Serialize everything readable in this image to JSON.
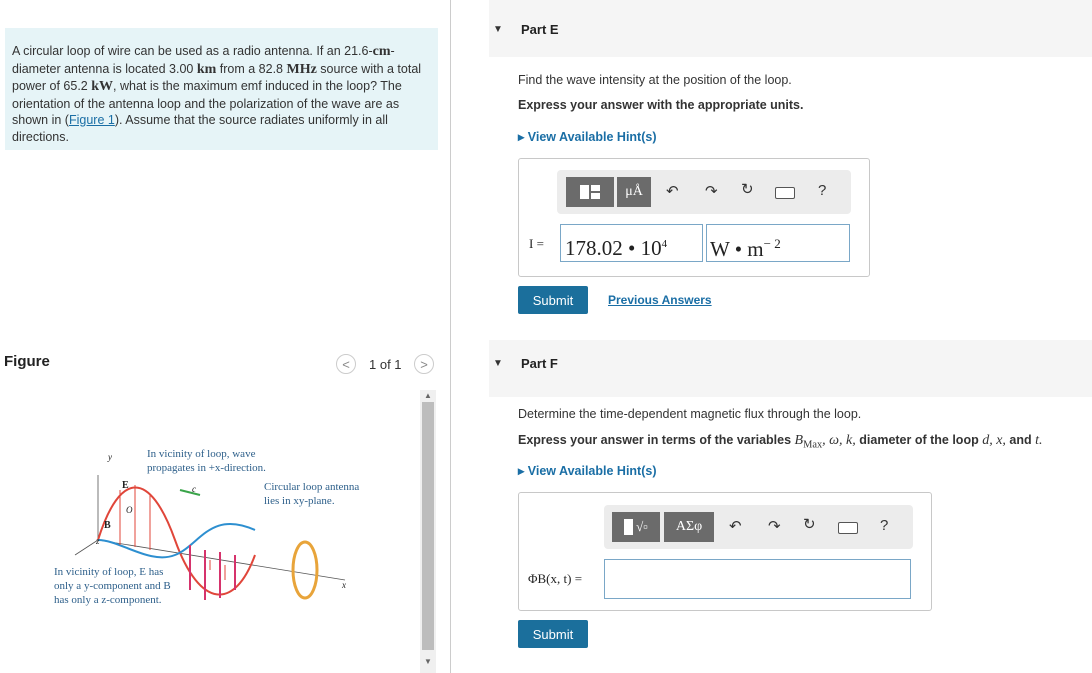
{
  "problem": {
    "text_1": "A circular loop of wire can be used as a radio antenna. If an 21.6-",
    "unit_cm": "cm",
    "text_2": "-diameter antenna is located 3.00 ",
    "unit_km": "km",
    "text_3": " from a 82.8 ",
    "unit_mhz": "MHz",
    "text_4": " source with a total power of 65.2 ",
    "unit_kw": "kW",
    "text_5": ", what is the maximum emf induced in the loop? The orientation of the antenna loop and the polarization of the wave are as shown in (",
    "figure_link": "Figure 1",
    "text_6": "). Assume that the source radiates uniformly in all directions."
  },
  "figure": {
    "title": "Figure",
    "counter": "1 of 1",
    "prev": "<",
    "next": ">",
    "caption_propagation": [
      "In vicinity of loop, wave",
      "propagates in +x-direction."
    ],
    "caption_loop": [
      "Circular loop antenna",
      "lies in xy-plane."
    ],
    "caption_components": [
      "In vicinity of loop, E has",
      "only a y-component and B",
      "has only a z-component."
    ],
    "labels": {
      "y": "y",
      "x": "x",
      "z": "z",
      "O": "O",
      "E": "E",
      "B": "B",
      "c": "c"
    }
  },
  "partE": {
    "label": "Part E",
    "question": "Find the wave intensity at the position of the loop.",
    "instruction": "Express your answer with the appropriate units.",
    "hint": "View Available Hint(s)",
    "toolbar_units": "μÅ",
    "help": "?",
    "var_label": "I =",
    "value": "178.02 • 10",
    "exponent": "4",
    "unit": "W • m",
    "unit_exp": "− 2",
    "submit": "Submit",
    "previous_answers": "Previous Answers"
  },
  "partF": {
    "label": "Part F",
    "question": "Determine the time-dependent magnetic flux through the loop.",
    "instruction_pre": "Express your answer in terms of the variables ",
    "instruction_vars": "B",
    "instruction_sub": "Max",
    "instruction_mid": ", ω, k, ",
    "instruction_post": "diameter of the loop ",
    "instruction_end": "d, x, ",
    "instruction_and": "and ",
    "instruction_t": "t.",
    "hint": "View Available Hint(s)",
    "toolbar_greek": "ΑΣφ",
    "help": "?",
    "var_label": "ΦB(x, t) =",
    "value": "",
    "submit": "Submit"
  },
  "colors": {
    "accent": "#1b6f9c",
    "problem_bg": "#e6f4f7",
    "link": "#1a6ea5"
  }
}
